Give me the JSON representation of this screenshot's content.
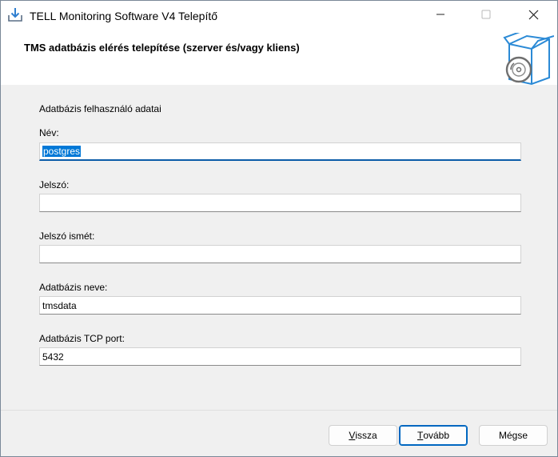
{
  "window": {
    "title": "TELL Monitoring Software V4 Telepítő"
  },
  "header": {
    "title": "TMS adatbázis elérés telepítése (szerver és/vagy kliens)"
  },
  "form": {
    "section_label": "Adatbázis felhasználó adatai",
    "fields": [
      {
        "label": "Név:",
        "value": "postgres"
      },
      {
        "label": "Jelszó:",
        "value": ""
      },
      {
        "label": "Jelszó ismét:",
        "value": ""
      },
      {
        "label": "Adatbázis neve:",
        "value": "tmsdata"
      },
      {
        "label": "Adatbázis TCP port:",
        "value": "5432"
      }
    ]
  },
  "buttons": {
    "back_first": "V",
    "back_rest": "issza",
    "next_first": "T",
    "next_rest": "ovább",
    "cancel": "Mégse"
  },
  "colors": {
    "accent": "#0067c0",
    "selection": "#0078d7",
    "content_bg": "#f0f0f0"
  },
  "icons": [
    "installer-download-icon",
    "minimize-icon",
    "maximize-icon",
    "close-icon",
    "install-box-disc-icon"
  ]
}
